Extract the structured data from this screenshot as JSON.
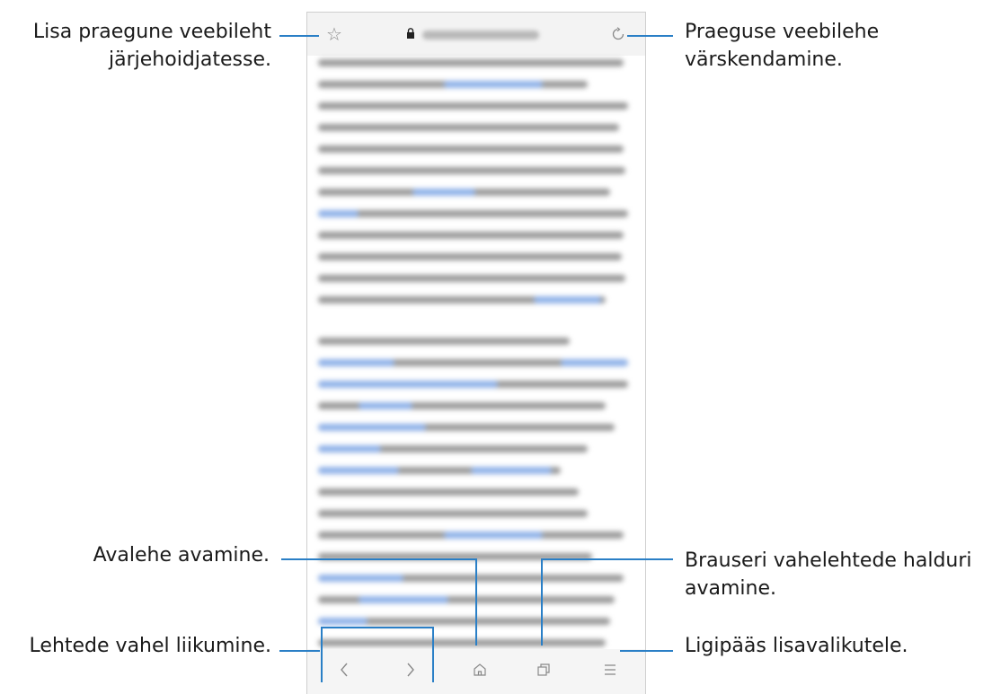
{
  "callouts": {
    "bookmark": [
      "Lisa praegune veebileht",
      "järjehoidjatesse."
    ],
    "refresh": [
      "Praeguse veebilehe",
      "värskendamine."
    ],
    "home": "Avalehe avamine.",
    "tabs": [
      "Brauseri vahelehtede halduri",
      "avamine."
    ],
    "navigate": "Lehtede vahel liikumine.",
    "more": "Ligipääs lisavalikutele."
  },
  "icons": {
    "bookmark": "star-icon",
    "lock": "lock-icon",
    "refresh": "refresh-icon",
    "back": "chevron-left-icon",
    "forward": "chevron-right-icon",
    "home": "home-icon",
    "tabs": "tabs-icon",
    "menu": "menu-icon"
  },
  "colors": {
    "callout_line": "#2a7fc6",
    "link_blur": "#8fb1e8"
  }
}
